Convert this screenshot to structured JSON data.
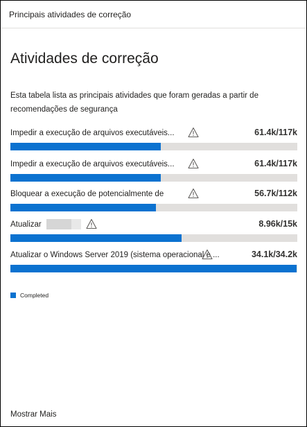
{
  "card": {
    "header_title": "Principais atividades de correção",
    "title": "Atividades de correção",
    "description": "Esta tabela lista as principais atividades que foram geradas a partir de recomendações de segurança",
    "show_more_label": "Mostrar Mais"
  },
  "activities": [
    {
      "label": "Impedir a execução de arquivos executáveis...",
      "value": "61.4k/117k",
      "completed": 61.4,
      "total": 117,
      "warning_icon": "warning-triangle"
    },
    {
      "label": "Impedir a execução de arquivos executáveis...",
      "value": "61.4k/117k",
      "completed": 61.4,
      "total": 117,
      "warning_icon": "warning-triangle"
    },
    {
      "label": "Bloquear a execução de potencialmente de",
      "value": "56.7k/112k",
      "completed": 56.7,
      "total": 112,
      "warning_icon": "warning-triangle"
    },
    {
      "label": "Atualizar",
      "value": "8.96k/15k",
      "completed": 8.96,
      "total": 15,
      "warning_icon": "warning-triangle"
    },
    {
      "label": "Atualizar o Windows Server 2019 (sistema operacional e ...",
      "value": "34.1k/34.2k",
      "completed": 34.1,
      "total": 34.2,
      "warning_icon": "warning-triangle"
    }
  ],
  "legend": {
    "label": "Completed",
    "color": "#0b72d0"
  },
  "colors": {
    "bar_fill": "#0b72d0",
    "bar_track": "#e1dfdd"
  }
}
